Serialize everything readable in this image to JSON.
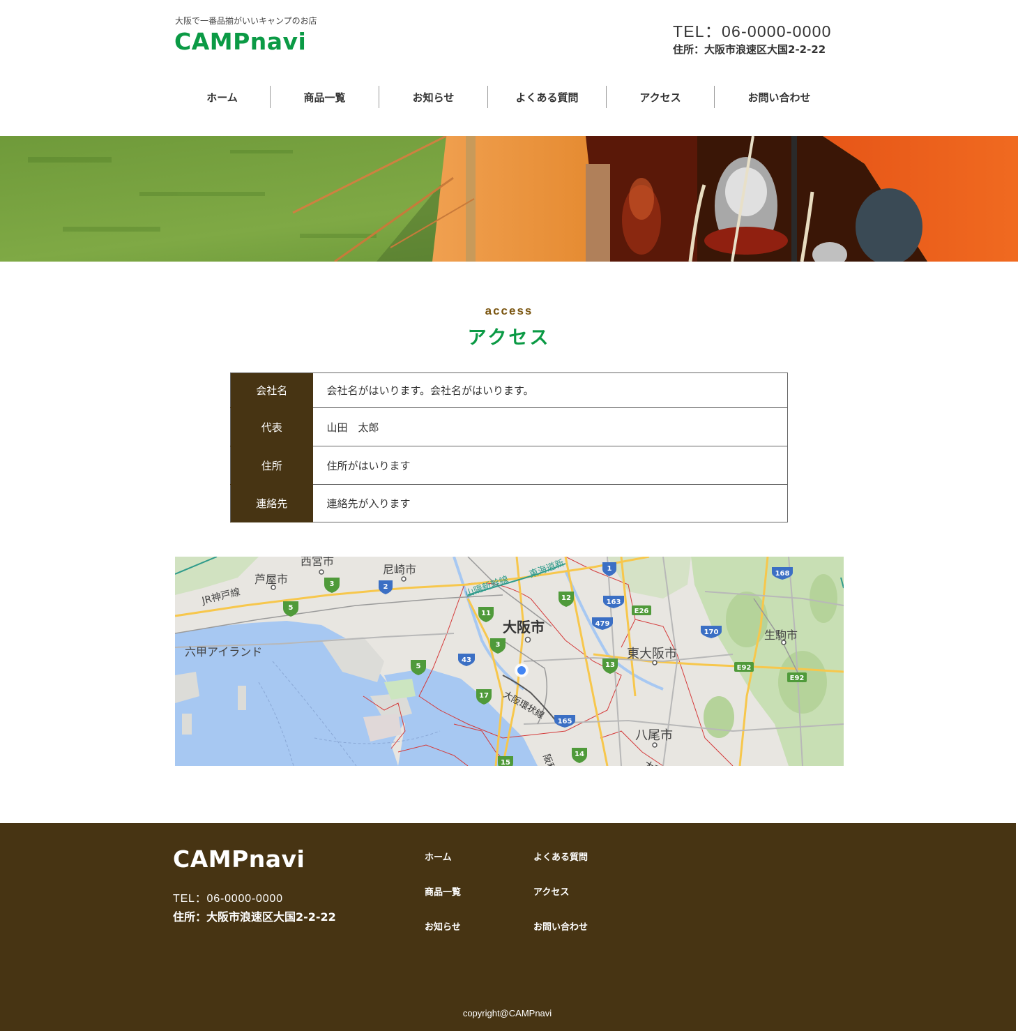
{
  "header": {
    "tagline": "大阪で一番品揃がいいキャンプのお店",
    "logo": "CAMPnavi",
    "tel": "TEL：06-0000-0000",
    "address": "住所：大阪市浪速区大国2-2-22"
  },
  "nav": {
    "items": [
      {
        "label": "ホーム"
      },
      {
        "label": "商品一覧"
      },
      {
        "label": "お知らせ"
      },
      {
        "label": "よくある質問"
      },
      {
        "label": "アクセス"
      },
      {
        "label": "お問い合わせ"
      }
    ]
  },
  "section": {
    "subtitle": "access",
    "title": "アクセス"
  },
  "company_table": {
    "rows": [
      {
        "label": "会社名",
        "value": "会社名がはいります。会社名がはいります。"
      },
      {
        "label": "代表",
        "value": "山田　太郎"
      },
      {
        "label": "住所",
        "value": "住所がはいります"
      },
      {
        "label": "連絡先",
        "value": "連絡先が入ります"
      }
    ]
  },
  "map": {
    "labels": {
      "nishinomiya": "西宮市",
      "amagasaki": "尼崎市",
      "ashiya": "芦屋市",
      "jr_kobe": "JR神戸線",
      "sanyo": "山陽新幹線",
      "tokaido": "東海道新",
      "osaka": "大阪市",
      "rokko": "六甲アイランド",
      "higashiosaka": "東大阪市",
      "ikoma": "生駒市",
      "kanjo": "大阪環状線",
      "yao": "八尾市",
      "hanwa": "阪和線",
      "yamato": "大和"
    },
    "shields": {
      "r1": "1",
      "r168": "168",
      "r3": "3",
      "r2": "2",
      "r12": "12",
      "r163": "163",
      "r5": "5",
      "r11": "11",
      "r479": "479",
      "e26": "E26",
      "r170": "170",
      "r3b": "3",
      "r43": "43",
      "r13": "13",
      "r5b": "5",
      "e92a": "E92",
      "e92b": "E92",
      "r17": "17",
      "r165": "165",
      "r14": "14",
      "r15": "15"
    }
  },
  "footer": {
    "logo": "CAMPnavi",
    "tel": "TEL：06-0000-0000",
    "address": "住所：大阪市浪速区大国2-2-22",
    "links": [
      {
        "label": "ホーム"
      },
      {
        "label": "よくある質問"
      },
      {
        "label": "商品一覧"
      },
      {
        "label": "アクセス"
      },
      {
        "label": "お知らせ"
      },
      {
        "label": "お問い合わせ"
      }
    ],
    "copyright": "copyright@CAMPnavi"
  },
  "colors": {
    "brand_green": "#0b9a45",
    "brand_brown": "#473413",
    "accent_brown": "#7a5510"
  }
}
